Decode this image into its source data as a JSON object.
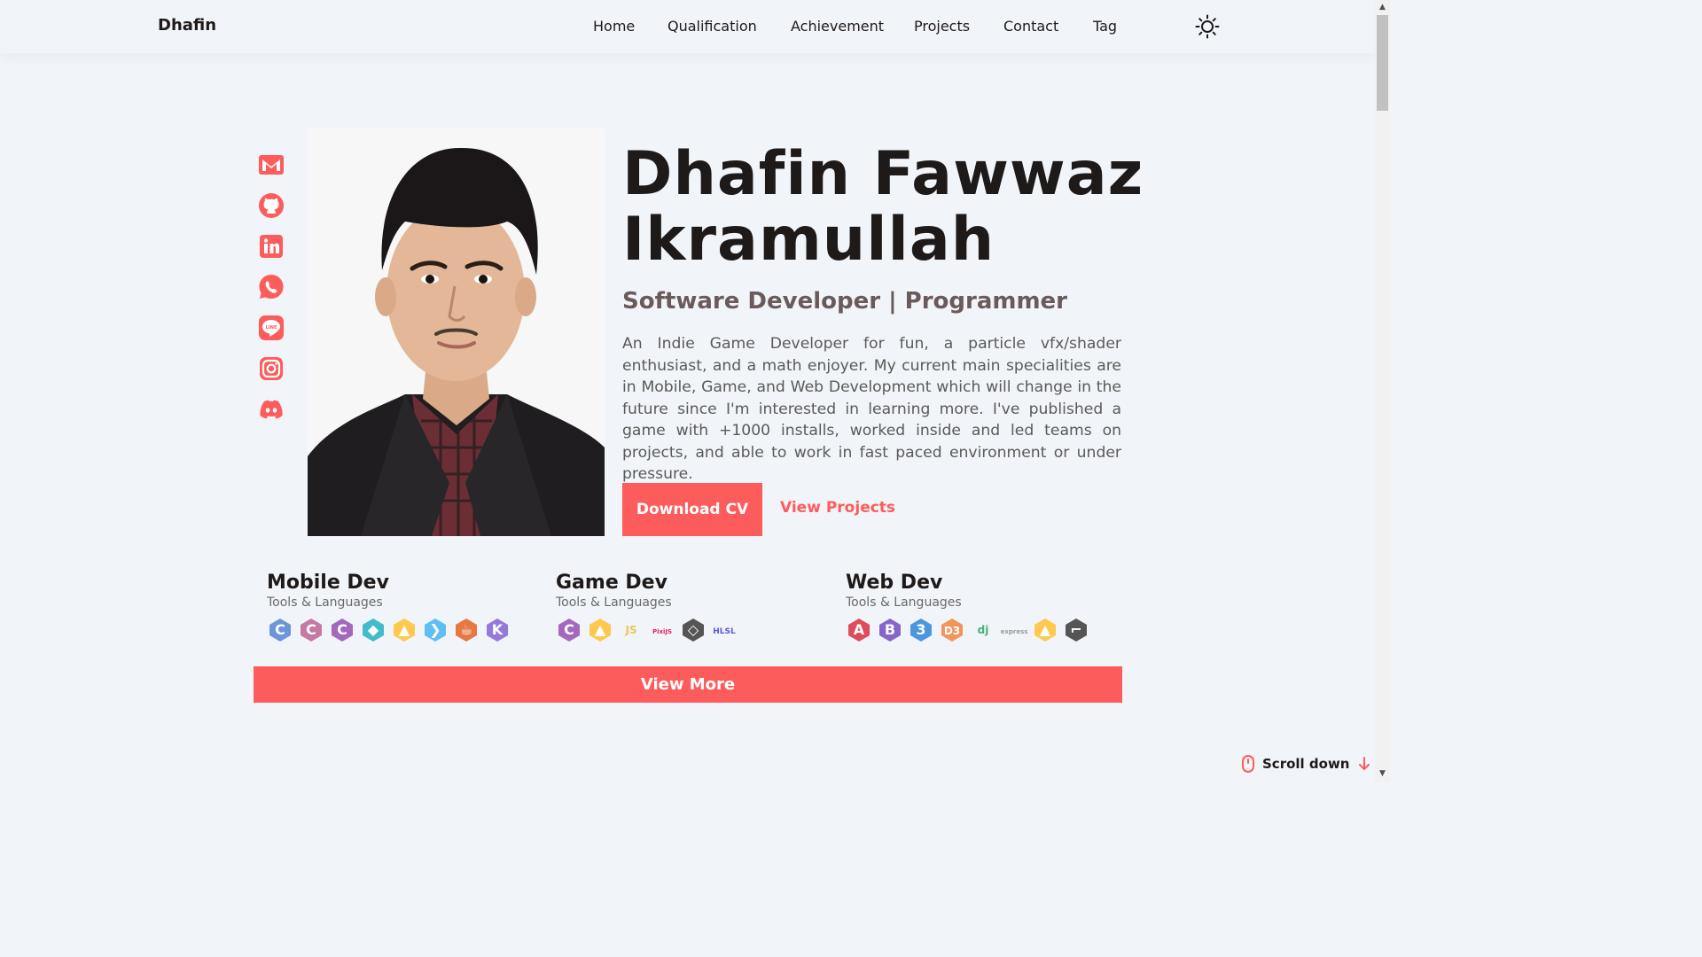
{
  "header": {
    "brand": "Dhafin",
    "nav": [
      {
        "label": "Home"
      },
      {
        "label": "Qualification"
      },
      {
        "label": "Achievement"
      },
      {
        "label": "Projects"
      },
      {
        "label": "Contact"
      },
      {
        "label": "Tag"
      }
    ],
    "theme_icon": "sun-icon"
  },
  "socials": [
    {
      "name": "gmail-icon"
    },
    {
      "name": "github-icon"
    },
    {
      "name": "linkedin-icon"
    },
    {
      "name": "whatsapp-icon"
    },
    {
      "name": "line-icon"
    },
    {
      "name": "instagram-icon"
    },
    {
      "name": "discord-icon"
    }
  ],
  "hero": {
    "name_line1": "Dhafin Fawwaz",
    "name_line2": "Ikramullah",
    "subtitle": "Software Developer | Programmer",
    "description": "An Indie Game Developer for fun, a particle vfx/shader enthusiast, and a math enjoyer. My current main specialities are in Mobile, Game, and Web Development which will change in the future since I'm interested in learning more. I've published a game with +1000 installs, worked inside and led teams on projects, and able to work in fast paced environment or under pressure.",
    "download_cv": "Download CV",
    "view_projects": "View Projects"
  },
  "skills": [
    {
      "title": "Mobile Dev",
      "subtitle": "Tools & Languages",
      "tools": [
        {
          "name": "c-icon",
          "glyph": "C",
          "color": "#5c8dd6"
        },
        {
          "name": "cpp-icon",
          "glyph": "C",
          "color": "#c06b9a"
        },
        {
          "name": "csharp-icon",
          "glyph": "C",
          "color": "#9b59b6"
        },
        {
          "name": "dart-icon",
          "glyph": "◆",
          "color": "#2fb6c4"
        },
        {
          "name": "firebase-icon",
          "glyph": "▲",
          "color": "#ffc43b"
        },
        {
          "name": "flutter-icon",
          "glyph": "❯",
          "color": "#4fb8f1"
        },
        {
          "name": "java-icon",
          "glyph": "☕",
          "color": "#e46a2f"
        },
        {
          "name": "kotlin-icon",
          "glyph": "K",
          "color": "#8b6bd8"
        }
      ]
    },
    {
      "title": "Game Dev",
      "subtitle": "Tools & Languages",
      "tools": [
        {
          "name": "csharp-icon",
          "glyph": "C",
          "color": "#9b59b6"
        },
        {
          "name": "firebase-icon",
          "glyph": "▲",
          "color": "#ffc43b"
        },
        {
          "name": "javascript-icon",
          "glyph": "JS",
          "color": "#e8c85a",
          "text": "JS"
        },
        {
          "name": "pixijs-icon",
          "glyph": "PixiJS",
          "color": "#e91e63",
          "text": "PixiJS"
        },
        {
          "name": "unity-icon",
          "glyph": "◇",
          "color": "#444444"
        },
        {
          "name": "hlsl-icon",
          "glyph": "HLSL",
          "color": "#5a5ad6",
          "text": "HLSL"
        }
      ]
    },
    {
      "title": "Web Dev",
      "subtitle": "Tools & Languages",
      "tools": [
        {
          "name": "angular-icon",
          "glyph": "A",
          "color": "#dd3a4a"
        },
        {
          "name": "bootstrap-icon",
          "glyph": "B",
          "color": "#7a56c4"
        },
        {
          "name": "css3-icon",
          "glyph": "3",
          "color": "#3b8ed8"
        },
        {
          "name": "d3-icon",
          "glyph": "D3",
          "color": "#f08c4a"
        },
        {
          "name": "django-icon",
          "glyph": "dj",
          "color": "#45b07a",
          "text": "dj"
        },
        {
          "name": "express-icon",
          "glyph": "express",
          "color": "#9a9a9a",
          "text": "express"
        },
        {
          "name": "firebase-icon",
          "glyph": "▲",
          "color": "#ffc43b"
        },
        {
          "name": "flask-icon",
          "glyph": "⌐",
          "color": "#444444"
        }
      ]
    }
  ],
  "view_more": "View More",
  "scroll_down": "Scroll down",
  "colors": {
    "accent": "#fd5c5c",
    "background": "#f1f4f8",
    "text": "#1f1a1a"
  }
}
